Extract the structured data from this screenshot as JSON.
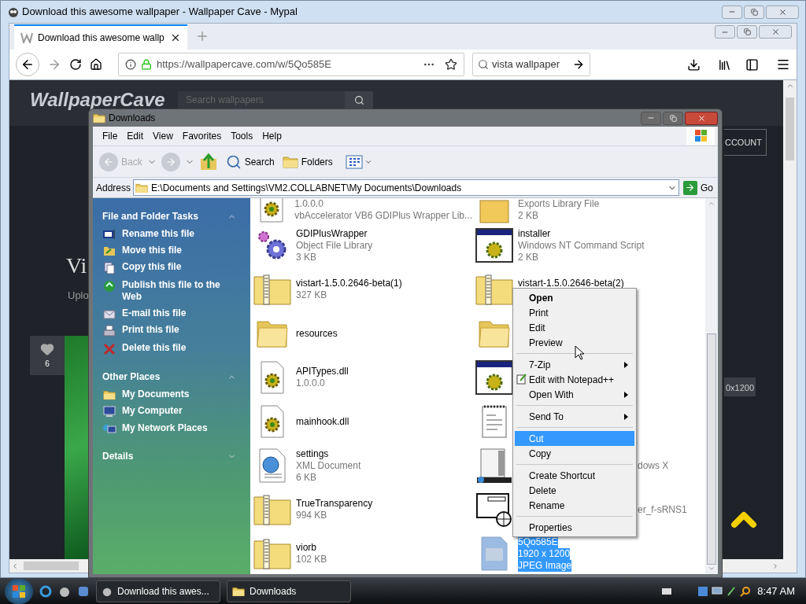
{
  "browser": {
    "title": "Download this awesome wallpaper - Wallpaper Cave - Mypal",
    "tabs": [
      {
        "label": "Download this awesome wallp",
        "selected": true
      }
    ],
    "url": "https://wallpapercave.com/w/5Qo585E",
    "search_value": "vista wallpaper"
  },
  "website": {
    "logo": "WallpaperCave",
    "search_placeholder": "Search wallpapers",
    "heading": "Vi",
    "subtext": "Uplo",
    "likes": "6",
    "account": "CCOUNT",
    "resolution": "0x1200"
  },
  "explorer": {
    "title": "Downloads",
    "menu": [
      "File",
      "Edit",
      "View",
      "Favorites",
      "Tools",
      "Help"
    ],
    "toolbar": {
      "back": "Back",
      "search": "Search",
      "folders": "Folders"
    },
    "address_label": "Address",
    "address": "E:\\Documents and Settings\\VM2.COLLABNET\\My Documents\\Downloads",
    "go": "Go",
    "sections": [
      {
        "title": "File and Folder Tasks",
        "expanded": true,
        "items": [
          {
            "label": "Rename this file",
            "kind": "rename"
          },
          {
            "label": "Move this file",
            "kind": "move"
          },
          {
            "label": "Copy this file",
            "kind": "copy"
          },
          {
            "label": "Publish this file to the Web",
            "kind": "publish"
          },
          {
            "label": "E-mail this file",
            "kind": "email"
          },
          {
            "label": "Print this file",
            "kind": "print"
          },
          {
            "label": "Delete this file",
            "kind": "delete"
          }
        ]
      },
      {
        "title": "Other Places",
        "expanded": true,
        "items": [
          {
            "label": "My Documents",
            "kind": "folder"
          },
          {
            "label": "My Computer",
            "kind": "computer"
          },
          {
            "label": "My Network Places",
            "kind": "network"
          }
        ]
      },
      {
        "title": "Details",
        "expanded": false
      }
    ],
    "files": [
      {
        "kind": "dll",
        "lines": [
          "1.0.0.0",
          "vbAccelerator VB6 GDIPlus Wrapper Lib..."
        ],
        "selected": false,
        "occluded": false
      },
      {
        "kind": "lib",
        "lines": [
          "Exports Library File",
          "2 KB"
        ],
        "selected": false,
        "occluded": false
      },
      {
        "kind": "object",
        "lines": [
          "GDIPlusWrapper",
          "Object File Library",
          "3 KB"
        ],
        "selected": false,
        "occluded": false,
        "lower_lines_hidden": false
      },
      {
        "kind": "script",
        "lines": [
          "installer",
          "Windows NT Command Script",
          "2 KB"
        ],
        "selected": false,
        "occluded": false,
        "lower_lines_hidden": false
      },
      {
        "kind": "zip",
        "lines": [
          "vistart-1.5.0.2646-beta(1)",
          "327 KB"
        ],
        "selected": false,
        "occluded": false,
        "lower_lines_hidden": false
      },
      {
        "kind": "zip",
        "lines": [
          "vistart-1.5.0.2646-beta(2)"
        ],
        "selected": false,
        "occluded": false,
        "lower_lines_hidden": true
      },
      {
        "kind": "folder",
        "lines": [
          "resources"
        ],
        "selected": false,
        "occluded": false,
        "lower_lines_hidden": false
      },
      {
        "kind": "folder",
        "selected": false
      },
      {
        "kind": "dll",
        "lines": [
          "APITypes.dll",
          "1.0.0.0"
        ],
        "selected": false,
        "occluded": false,
        "lower_lines_hidden": false
      },
      {
        "kind": "script",
        "selected": false
      },
      {
        "kind": "dll",
        "lines": [
          "mainhook.dll"
        ],
        "selected": false,
        "occluded": false,
        "lower_lines_hidden": false
      },
      {
        "kind": "text",
        "selected": false
      },
      {
        "kind": "xml",
        "lines": [
          "settings",
          "XML Document",
          "6 KB"
        ],
        "selected": false,
        "occluded": false,
        "lower_lines_hidden": false
      },
      {
        "kind": "app",
        "lines": [
          "dows X"
        ],
        "selected": false,
        "occluded": true,
        "lower_lines_hidden": false
      },
      {
        "kind": "zip",
        "lines": [
          "TrueTransparency",
          "994 KB"
        ],
        "selected": false,
        "occluded": false,
        "lower_lines_hidden": false
      },
      {
        "kind": "web",
        "lines": [
          "er_f-sRNS1"
        ],
        "selected": false,
        "occluded": true,
        "lower_lines_hidden": false
      },
      {
        "kind": "zip",
        "lines": [
          "viorb",
          "102 KB"
        ],
        "selected": false,
        "occluded": false,
        "lower_lines_hidden": false
      },
      {
        "kind": "image",
        "lines": [
          "5Qo585E",
          "1920 x 1200",
          "JPEG Image"
        ],
        "selected": true,
        "occluded": false,
        "lower_lines_hidden": false
      }
    ],
    "context_menu": [
      {
        "kind": "item",
        "label": "Open",
        "default": true,
        "submenu": false,
        "selected": false
      },
      {
        "kind": "item",
        "label": "Print",
        "default": false,
        "submenu": false,
        "selected": false
      },
      {
        "kind": "item",
        "label": "Edit",
        "default": false,
        "submenu": false,
        "selected": false
      },
      {
        "kind": "item",
        "label": "Preview",
        "default": false,
        "submenu": false,
        "selected": false
      },
      {
        "kind": "separator"
      },
      {
        "kind": "item",
        "label": "7-Zip",
        "default": false,
        "submenu": true,
        "selected": false
      },
      {
        "kind": "iconitem",
        "label": "Edit with Notepad++",
        "default": false,
        "submenu": false,
        "selected": false
      },
      {
        "kind": "item",
        "label": "Open With",
        "default": false,
        "submenu": true,
        "selected": false
      },
      {
        "kind": "separator"
      },
      {
        "kind": "item",
        "label": "Send To",
        "default": false,
        "submenu": true,
        "selected": false
      },
      {
        "kind": "separator"
      },
      {
        "kind": "item",
        "label": "Cut",
        "default": false,
        "submenu": false,
        "selected": true
      },
      {
        "kind": "item",
        "label": "Copy",
        "default": false,
        "submenu": false,
        "selected": false
      },
      {
        "kind": "separator"
      },
      {
        "kind": "item",
        "label": "Create Shortcut",
        "default": false,
        "submenu": false,
        "selected": false
      },
      {
        "kind": "item",
        "label": "Delete",
        "default": false,
        "submenu": false,
        "selected": false
      },
      {
        "kind": "item",
        "label": "Rename",
        "default": false,
        "submenu": false,
        "selected": false
      },
      {
        "kind": "separator"
      },
      {
        "kind": "item",
        "label": "Properties",
        "default": false,
        "submenu": false,
        "selected": false
      }
    ]
  },
  "taskbar": {
    "tasks": [
      {
        "label": "Download this awes...",
        "kind": "browser"
      },
      {
        "label": "Downloads",
        "kind": "folder"
      }
    ],
    "time": "8:47 AM"
  }
}
